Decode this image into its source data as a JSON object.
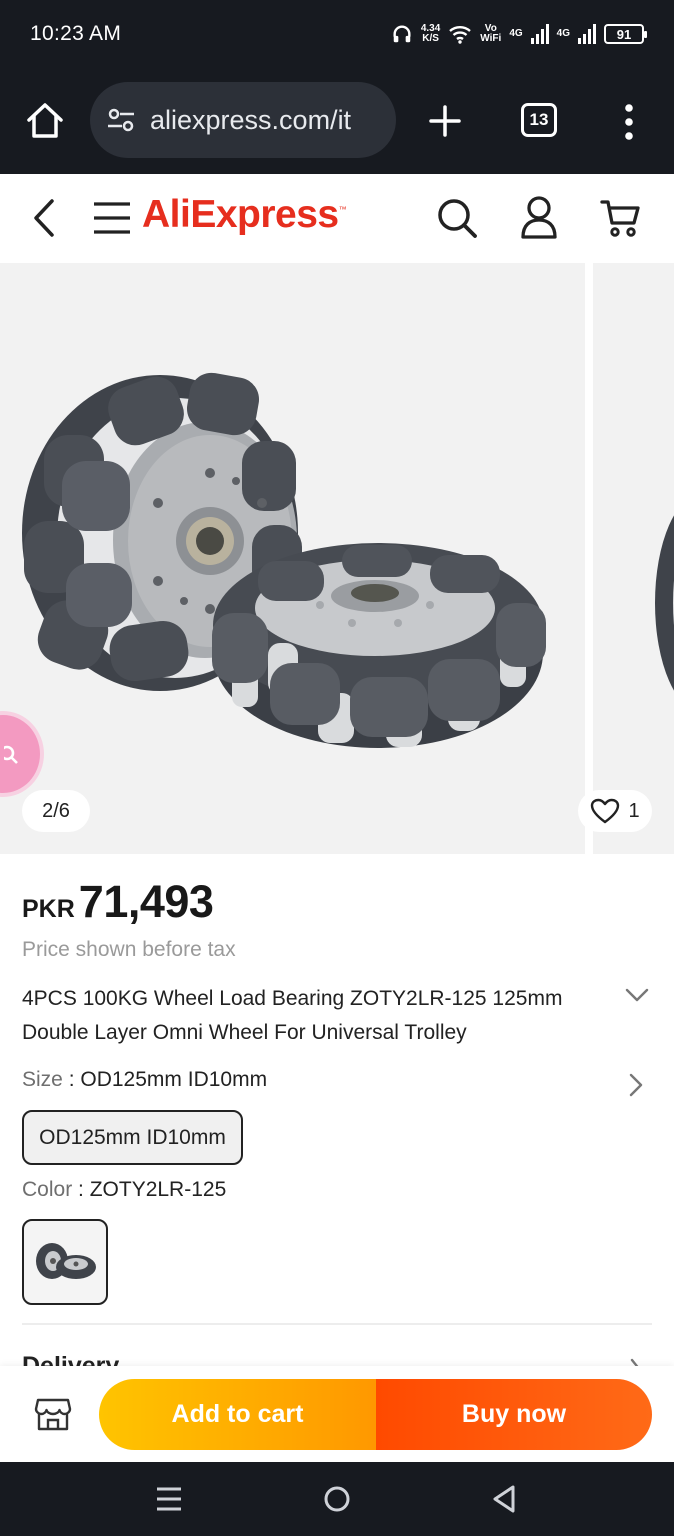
{
  "status_bar": {
    "time": "10:23 AM",
    "net_speed_value": "4.34",
    "net_speed_unit": "K/S",
    "volte_top": "Vo",
    "volte_bottom": "WiFi",
    "sim1_label": "4G",
    "sim2_label": "4G",
    "battery": "91"
  },
  "browser": {
    "url": "aliexpress.com/it",
    "tab_count": "13"
  },
  "header": {
    "logo_text": "AliExpress",
    "logo_mark": "™"
  },
  "gallery": {
    "counter": "2/6",
    "wishlist_count": "1"
  },
  "product": {
    "currency": "PKR",
    "price": "71,493",
    "tax_note": "Price shown before tax",
    "title": "4PCS 100KG Wheel Load Bearing ZOTY2LR-125 125mm Double Layer Omni Wheel For Universal Trolley",
    "size_label": "Size",
    "size_value": "OD125mm ID10mm",
    "size_option": "OD125mm ID10mm",
    "color_label": "Color",
    "color_value": "ZOTY2LR-125",
    "delivery_label": "Delivery"
  },
  "actions": {
    "add_to_cart": "Add to cart",
    "buy_now": "Buy now"
  },
  "colors": {
    "brand_red": "#e62e1e",
    "cart_gradient_start": "#ffc400",
    "buy_gradient_end": "#ff6a17",
    "status_bg": "#171a20"
  }
}
